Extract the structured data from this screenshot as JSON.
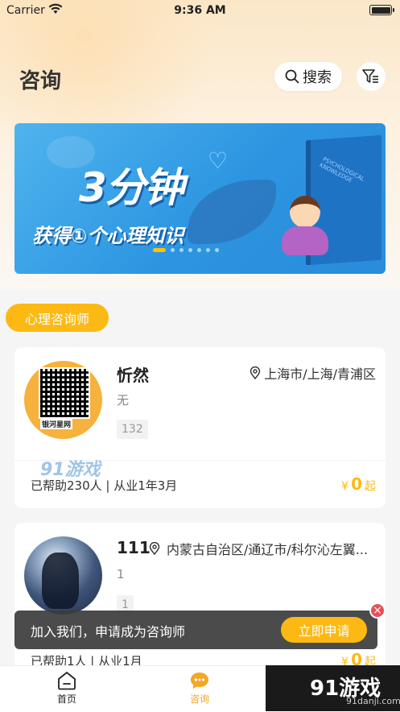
{
  "status": {
    "carrier": "Carrier",
    "time": "9:36 AM"
  },
  "header": {
    "title": "咨询",
    "search_label": "搜索"
  },
  "banner": {
    "big_text": "3分钟",
    "sub_text": "获得①个心理知识",
    "book_text": "PSYCHOLOGICAL KNOWLEDGE",
    "slide_count": 7,
    "active_slide": 1
  },
  "section": {
    "tag": "心理咨询师"
  },
  "counselors": [
    {
      "name": "忻然",
      "location": "上海市/上海/青浦区",
      "intro": "无",
      "tag": "132",
      "stats": "已帮助230人 | 从业1年3月",
      "currency": "¥",
      "price": "0",
      "price_suffix": "起",
      "avatar_text": "银河星网"
    },
    {
      "name": "111",
      "location": "内蒙古自治区/通辽市/科尔沁左翼...",
      "intro": "1",
      "tag": "1",
      "stats": "已帮助1人 | 从业1月",
      "currency": "¥",
      "price": "0",
      "price_suffix": "起"
    }
  ],
  "join_bar": {
    "text": "加入我们，申请成为咨询师",
    "button": "立即申请",
    "close": "×"
  },
  "tabbar": {
    "home": "首页",
    "consult": "咨询"
  },
  "watermark": {
    "text1": "91游戏",
    "text2": "91游戏",
    "site": "91danji.com"
  },
  "colors": {
    "accent": "#fdb913",
    "tab_active": "#f5a623"
  }
}
